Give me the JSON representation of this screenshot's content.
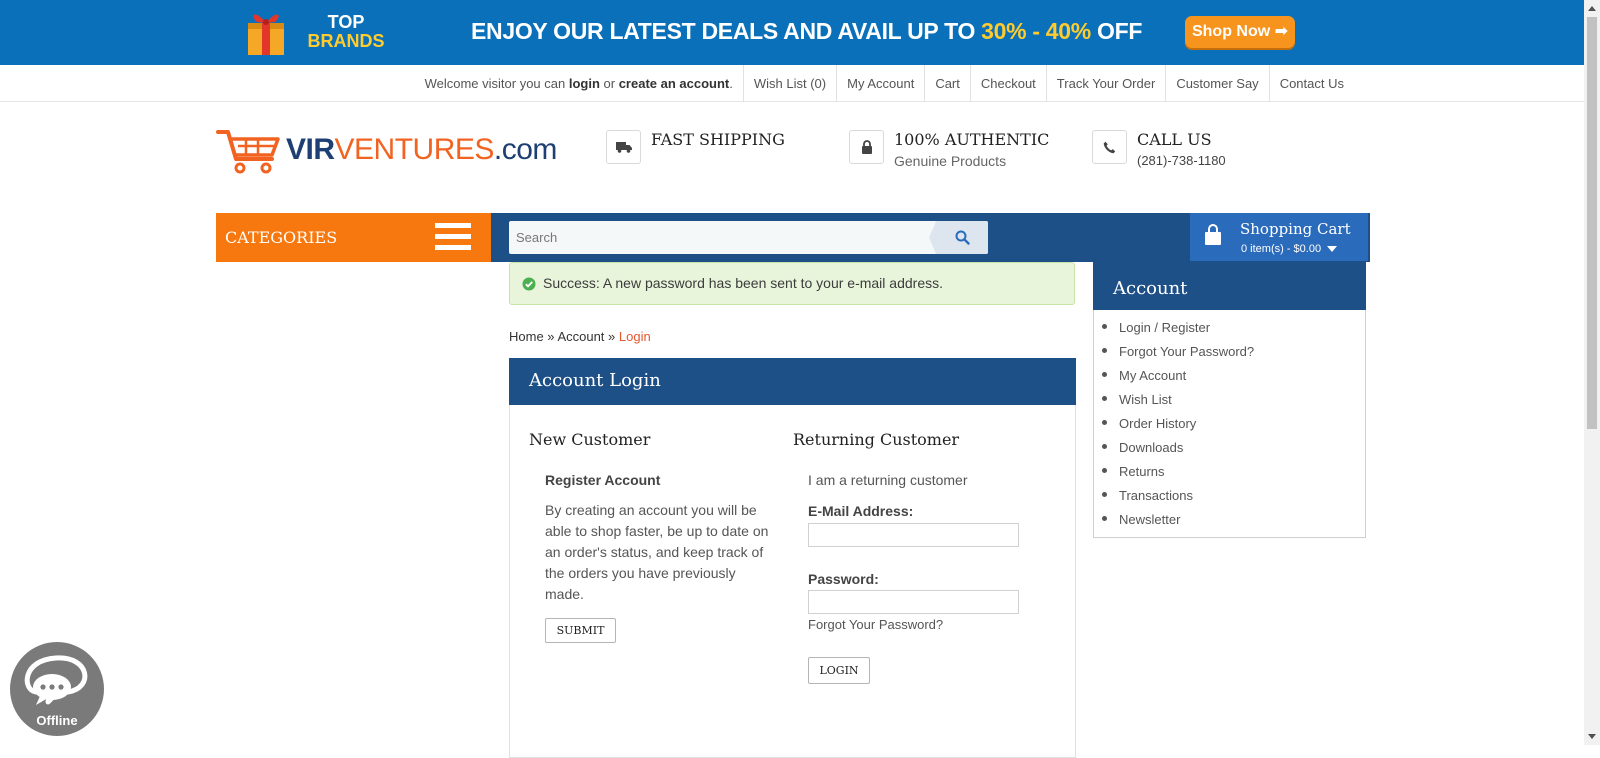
{
  "promo": {
    "brand_line1": "TOP",
    "brand_line2": "BRANDS",
    "text_main": "ENJOY OUR LATEST DEALS AND AVAIL UP TO ",
    "text_highlight": "30% - 40%",
    "text_end": " OFF",
    "button": "Shop Now ➡"
  },
  "toplinks": {
    "welcome_prefix": "Welcome visitor you can ",
    "login": "login",
    "or": " or ",
    "create": "create an account",
    "period": ".",
    "items": [
      "Wish List (0)",
      "My Account",
      "Cart",
      "Checkout",
      "Track Your Order",
      "Customer Say",
      "Contact Us"
    ]
  },
  "logo": {
    "vir": "VIR",
    "ventures": "VENTURES",
    "com": ".com"
  },
  "features": [
    {
      "title": "FAST SHIPPING",
      "sub": "",
      "icon": "truck-icon"
    },
    {
      "title": "100% AUTHENTIC",
      "sub": "Genuine Products",
      "icon": "lock-icon"
    },
    {
      "title": "CALL US",
      "sub": "(281)-738-1180",
      "icon": "phone-icon"
    }
  ],
  "nav": {
    "categories": "CATEGORIES",
    "search_placeholder": "Search",
    "cart_title": "Shopping Cart",
    "cart_summary": "0 item(s) - $0.00"
  },
  "alert": {
    "text": "Success: A new password has been sent to your e-mail address."
  },
  "breadcrumb": {
    "home": "Home",
    "sep": " » ",
    "account": "Account",
    "current": "Login"
  },
  "login": {
    "title": "Account Login",
    "new_customer": {
      "heading": "New Customer",
      "subheading": "Register Account",
      "text": "By creating an account you will be able to shop faster, be up to date on an order's status, and keep track of the orders you have previously made.",
      "button": "SUBMIT"
    },
    "returning_customer": {
      "heading": "Returning Customer",
      "intro": "I am a returning customer",
      "email_label": "E-Mail Address:",
      "email_value": "",
      "password_label": "Password:",
      "password_value": "",
      "forgot": "Forgot Your Password?",
      "button": "LOGIN"
    }
  },
  "account_menu": {
    "title": "Account",
    "items": [
      "Login / Register",
      "Forgot Your Password?",
      "My Account",
      "Wish List",
      "Order History",
      "Downloads",
      "Returns",
      "Transactions",
      "Newsletter"
    ]
  },
  "chat": {
    "status": "Offline"
  },
  "colors": {
    "promo_bg": "#0a70b9",
    "highlight_yellow": "#ffcc2f",
    "orange": "#f7780e",
    "navy": "#1e5088",
    "cart_blue": "#2b6bbb",
    "success_bg": "#e8f5db",
    "link_accent": "#e4572e"
  }
}
